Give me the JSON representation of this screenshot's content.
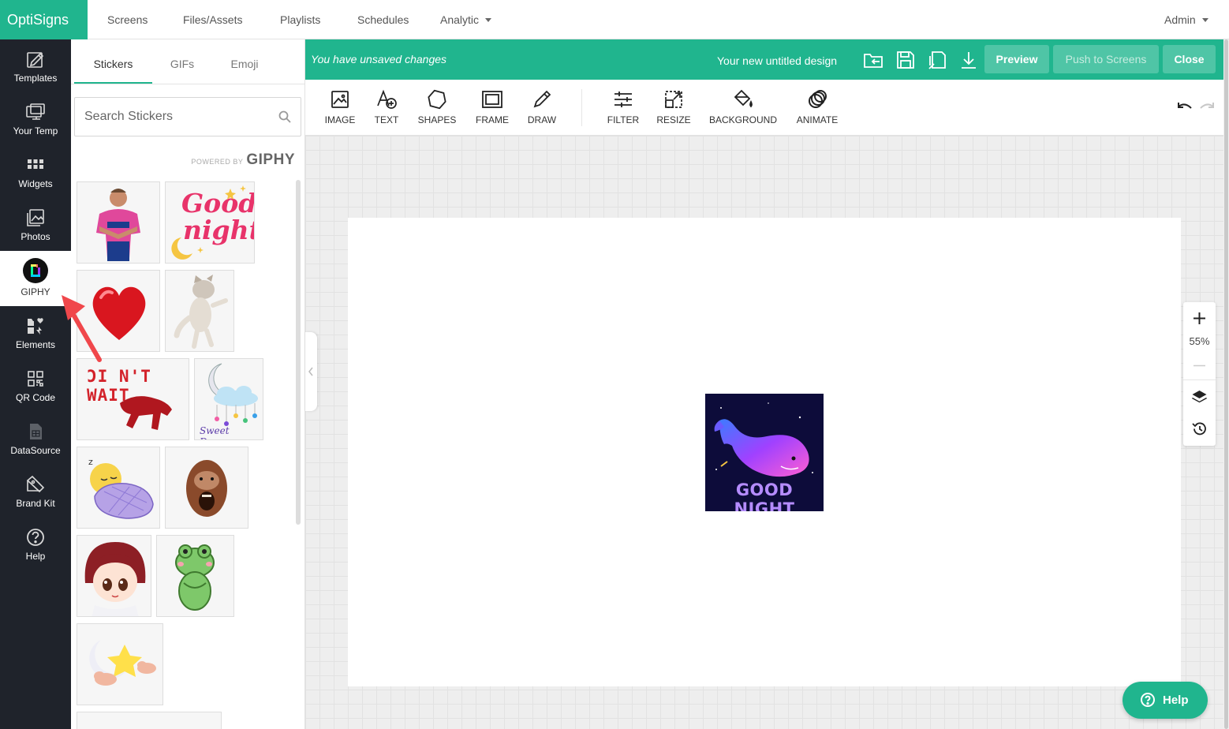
{
  "topnav": {
    "brand": "OptiSigns",
    "items": [
      "Screens",
      "Files/Assets",
      "Playlists",
      "Schedules",
      "Analytic"
    ],
    "user": "Admin"
  },
  "rail": {
    "items": [
      {
        "label": "Templates",
        "icon": "templates-icon"
      },
      {
        "label": "Your Temp",
        "icon": "your-templates-icon"
      },
      {
        "label": "Widgets",
        "icon": "widgets-icon"
      },
      {
        "label": "Photos",
        "icon": "photos-icon"
      },
      {
        "label": "GIPHY",
        "icon": "giphy-icon",
        "active": true
      },
      {
        "label": "Elements",
        "icon": "elements-icon"
      },
      {
        "label": "QR Code",
        "icon": "qr-code-icon"
      },
      {
        "label": "DataSource",
        "icon": "datasource-icon"
      },
      {
        "label": "Brand Kit",
        "icon": "brand-kit-icon"
      },
      {
        "label": "Help",
        "icon": "help-icon"
      }
    ]
  },
  "panel": {
    "tabs": [
      "Stickers",
      "GIFs",
      "Emoji"
    ],
    "active_tab": "Stickers",
    "search_placeholder": "Search Stickers",
    "powered_small": "POWERED BY",
    "powered_big": "GIPHY",
    "stickers": [
      {
        "name": "cricket-player"
      },
      {
        "name": "good-night",
        "text1": "Good",
        "text2": "night"
      },
      {
        "name": "heart"
      },
      {
        "name": "cat"
      },
      {
        "name": "cant-wait",
        "text": "ƆI N'T WAIT"
      },
      {
        "name": "sweet-dreams",
        "text": "Sweet Dreams"
      },
      {
        "name": "sleeping-chick"
      },
      {
        "name": "orangutan"
      },
      {
        "name": "anime-girl"
      },
      {
        "name": "frog"
      },
      {
        "name": "sleepy-star"
      }
    ]
  },
  "header": {
    "unsaved": "You have unsaved changes",
    "design_name": "Your new untitled design",
    "preview": "Preview",
    "push": "Push to Screens",
    "close": "Close"
  },
  "toolbar": {
    "tools": [
      "IMAGE",
      "TEXT",
      "SHAPES",
      "FRAME",
      "DRAW",
      "FILTER",
      "RESIZE",
      "BACKGROUND",
      "ANIMATE"
    ]
  },
  "canvas": {
    "element_text": "GOOD NIGHT",
    "zoom": "55%"
  },
  "help_fab": "Help",
  "colors": {
    "brand": "#20b58e",
    "rail": "#1f232b",
    "button": "#4fc5a6"
  }
}
